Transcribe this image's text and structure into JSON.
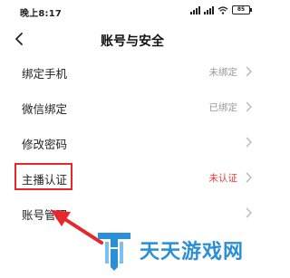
{
  "status_bar": {
    "time": "晚上8:17",
    "battery": "85"
  },
  "header": {
    "title": "账号与安全"
  },
  "settings": [
    {
      "label": "绑定手机",
      "value": "未绑定"
    },
    {
      "label": "微信绑定",
      "value": "已绑定"
    },
    {
      "label": "修改密码",
      "value": ""
    },
    {
      "label": "主播认证",
      "value": "未认证"
    },
    {
      "label": "账号管理",
      "value": ""
    }
  ],
  "colors": {
    "accent": "#e8262b",
    "alert_value": "#e83a3a",
    "watermark": "#2a8fd6"
  },
  "watermark": {
    "text": "天天游戏网"
  }
}
